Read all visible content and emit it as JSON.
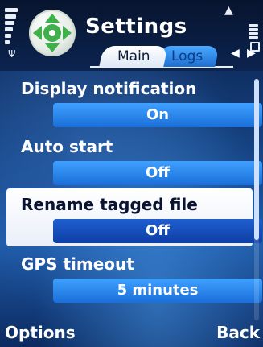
{
  "header": {
    "title": "Settings",
    "app_icon": "gps-navigator-icon",
    "tabs": [
      {
        "label": "Main",
        "active": true
      },
      {
        "label": "Logs",
        "active": false
      }
    ]
  },
  "settings": [
    {
      "label": "Display notification",
      "value": "On",
      "focused": false
    },
    {
      "label": "Auto start",
      "value": "Off",
      "focused": false
    },
    {
      "label": "Rename tagged file",
      "value": "Off",
      "focused": true
    },
    {
      "label": "GPS timeout",
      "value": "5 minutes",
      "focused": false
    }
  ],
  "softkeys": {
    "left": "Options",
    "right": "Back"
  },
  "colors": {
    "accent": "#2b86f0",
    "focus_background": "#ffffff",
    "header_background": "#07142e"
  }
}
